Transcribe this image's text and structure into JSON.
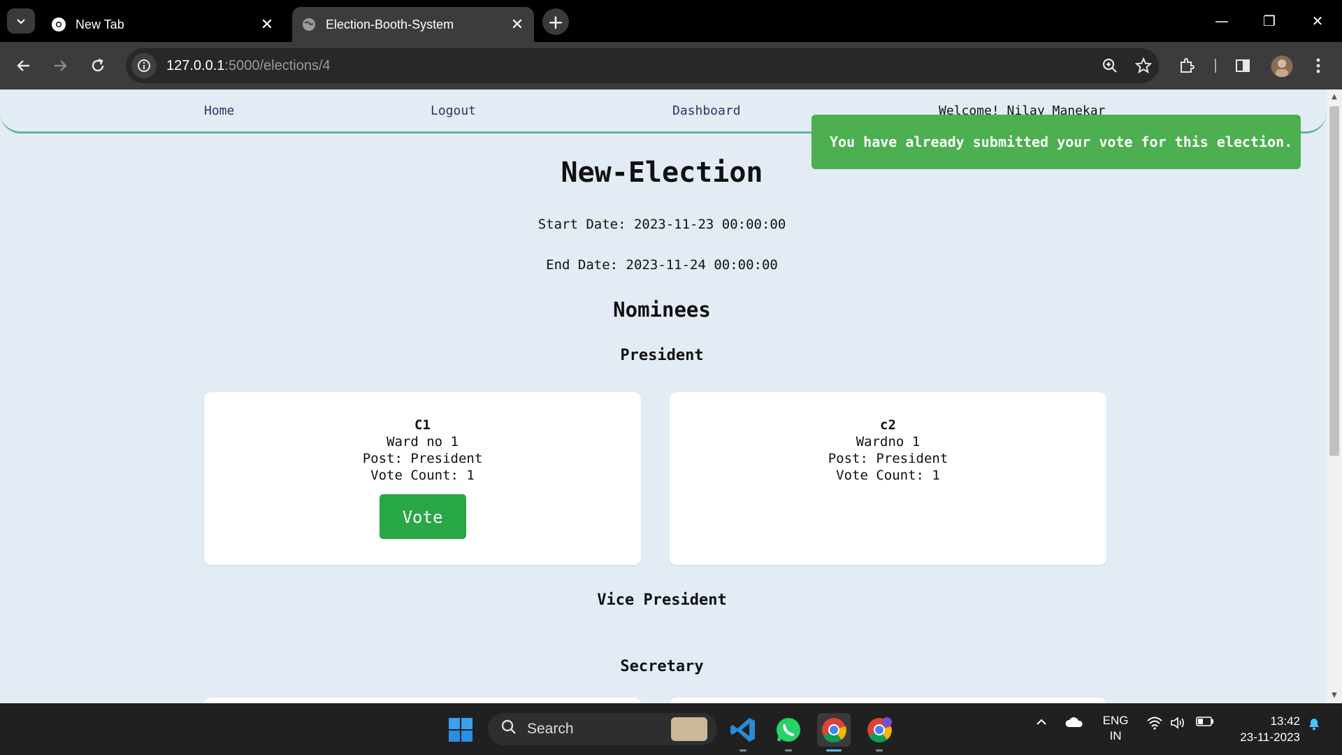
{
  "browser": {
    "tabs": [
      {
        "title": "New Tab",
        "active": false
      },
      {
        "title": "Election-Booth-System",
        "active": true
      }
    ],
    "url_host": "127.0.0.1",
    "url_path": ":5000/elections/4"
  },
  "site_nav": {
    "home": "Home",
    "logout": "Logout",
    "dashboard": "Dashboard",
    "welcome": "Welcome! Nilay Manekar"
  },
  "flash_message": "You have already submitted your vote for this election.",
  "election": {
    "title": "New-Election",
    "start_date": "Start Date: 2023-11-23 00:00:00",
    "end_date": "End Date: 2023-11-24 00:00:00",
    "nominees_heading": "Nominees",
    "posts": [
      {
        "name": "President"
      },
      {
        "name": "Vice President"
      },
      {
        "name": "Secretary"
      }
    ],
    "candidates": [
      {
        "name": "C1",
        "ward": "Ward no 1",
        "post": "Post: President",
        "votes": "Vote Count: 1",
        "vote_label": "Vote"
      },
      {
        "name": "c2",
        "ward": "Wardno 1",
        "post": "Post: President",
        "votes": "Vote Count: 1"
      }
    ]
  },
  "taskbar": {
    "search_placeholder": "Search",
    "lang_line1": "ENG",
    "lang_line2": "IN",
    "time": "13:42",
    "date": "23-11-2023"
  },
  "colors": {
    "page_bg": "#e3ecf4",
    "nav_border": "#5bb89a",
    "toast_bg": "#4caf50",
    "vote_button": "#28a745"
  }
}
